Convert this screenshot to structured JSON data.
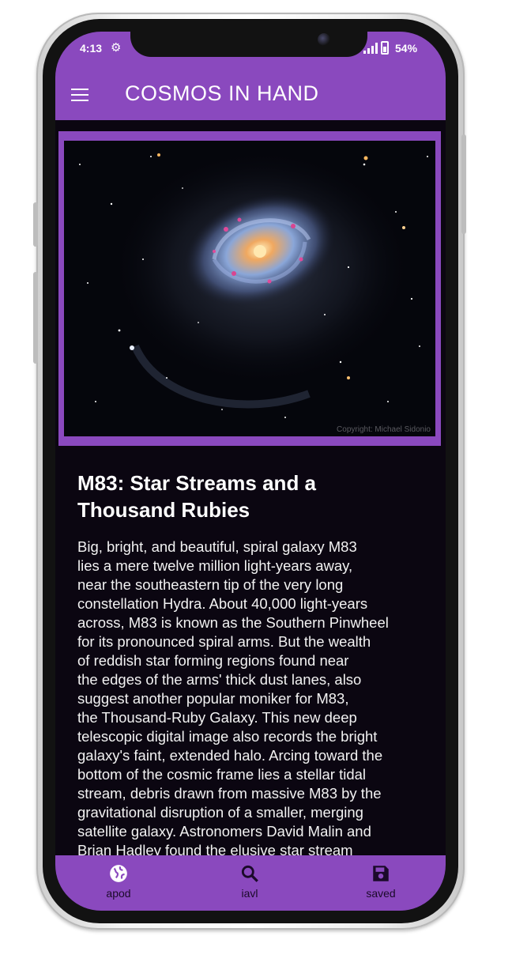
{
  "status_bar": {
    "time": "4:13",
    "battery": "54%",
    "icons": [
      "gear-icon",
      "signal-icon",
      "battery-icon"
    ]
  },
  "app_bar": {
    "title": "COSMOS IN HAND",
    "menu_icon": "hamburger-menu-icon"
  },
  "apod": {
    "image_credit": "Copyright: Michael Sidonio",
    "title": "M83: Star Streams and a Thousand Rubies",
    "body_lines": [
      "Big, bright, and beautiful, spiral galaxy M83",
      "lies a mere twelve million light-years away,",
      "near the southeastern tip of the very long",
      "constellation Hydra. About 40,000 light-years",
      "across, M83 is known as the Southern Pinwheel",
      "for its pronounced spiral arms. But the wealth",
      "of reddish star forming regions found near",
      "the edges of the arms' thick dust lanes, also",
      "suggest another popular moniker for M83,",
      "the Thousand-Ruby Galaxy. This new deep",
      "telescopic digital image also records the bright",
      "galaxy's faint, extended halo. Arcing toward the",
      "bottom of the cosmic frame lies a stellar tidal",
      "stream, debris drawn from massive M83 by the",
      "gravitational disruption of a smaller, merging",
      "satellite galaxy. Astronomers David Malin and",
      "Brian Hadley found the elusive star stream"
    ]
  },
  "bottom_nav": [
    {
      "label": "apod",
      "icon": "globe-icon"
    },
    {
      "label": "iavl",
      "icon": "search-icon"
    },
    {
      "label": "saved",
      "icon": "save-icon"
    }
  ],
  "colors": {
    "accent": "#8a49be",
    "background": "#0b0611",
    "nav_text": "#1b0a2a"
  }
}
